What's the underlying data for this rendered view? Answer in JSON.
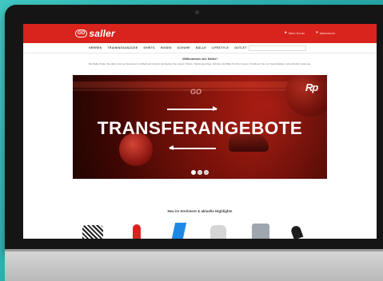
{
  "site": {
    "logo_mark": "GO",
    "logo_text": "saller",
    "top_links": [
      {
        "icon": "user-icon",
        "label": "Mein Konto"
      },
      {
        "icon": "cart-icon",
        "label": "Warenkorb"
      }
    ]
  },
  "nav": {
    "items": [
      "HERREN",
      "TRAININGSANZÜGE",
      "SHIRTS",
      "HOSEN",
      "SCHUHE",
      "BÄLLE",
      "LIFESTYLE",
      "OUTLET"
    ]
  },
  "welcome": {
    "title": "Willkommen bei Saller!",
    "text": "Bei Saller finden Sie alles rund um Teamsport, Fußball und Freizeit. Entdecken Sie unsere Trikots, Trainingsanzüge, Schuhe und Bälle für Ihren Verein. Profitieren Sie von Teamrabatten und schneller Lieferung."
  },
  "hero": {
    "title": "TRANSFERANGEBOTE",
    "brand_mark": "GO",
    "corner_mark": "Rp",
    "slides": 3,
    "active_slide": 1
  },
  "section": {
    "title": "Neu im Sortiment & aktuelle Highlights"
  },
  "colors": {
    "brand_red": "#d9231d",
    "hero_dark": "#4e0905",
    "background_teal": "#2fb8b4"
  }
}
